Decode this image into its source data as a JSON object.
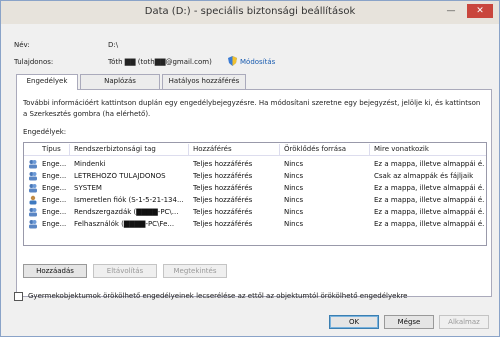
{
  "window": {
    "title": "Data (D:) - speciális biztonsági beállítások",
    "minimize_glyph": "—",
    "close_glyph": "✕"
  },
  "info": {
    "name_label": "Név:",
    "name_value": "D:\\",
    "owner_label": "Tulajdonos:",
    "owner_value": "Tóth ▇▇ (toth▇▇@gmail.com)",
    "change_link": "Módosítás",
    "change_icon": "shield-icon"
  },
  "tabs": [
    {
      "label": "Engedélyek",
      "active": true
    },
    {
      "label": "Naplózás",
      "active": false
    },
    {
      "label": "Hatályos hozzáférés",
      "active": false
    }
  ],
  "permissions": {
    "description": "További információért kattintson duplán egy engedélybejegyzésre. Ha módosítani szeretne egy bejegyzést, jelölje ki, és kattintson a Szerkesztés gombra (ha elérhető).",
    "list_label": "Engedélyek:",
    "columns": [
      "Típus",
      "Rendszerbiztonsági tag",
      "Hozzáférés",
      "Öröklődés forrása",
      "Mire vonatkozik"
    ],
    "rows": [
      {
        "type": "Enge...",
        "principal": "Mindenki",
        "access": "Teljes hozzáférés",
        "inherited": "Nincs",
        "applies": "Ez a mappa, illetve almappái é..."
      },
      {
        "type": "Enge...",
        "principal": "LÉTREHOZÓ TULAJDONOS",
        "access": "Teljes hozzáférés",
        "inherited": "Nincs",
        "applies": "Csak az almappák és fájljaik"
      },
      {
        "type": "Enge...",
        "principal": "SYSTEM",
        "access": "Teljes hozzáférés",
        "inherited": "Nincs",
        "applies": "Ez a mappa, illetve almappái é..."
      },
      {
        "type": "Enge...",
        "principal": "Ismeretlen fiók (S-1-5-21-134...",
        "access": "Teljes hozzáférés",
        "inherited": "Nincs",
        "applies": "Ez a mappa, illetve almappái é..."
      },
      {
        "type": "Enge...",
        "principal": "Rendszergazdák (▇▇▇▇-PC\\...",
        "access": "Teljes hozzáférés",
        "inherited": "Nincs",
        "applies": "Ez a mappa, illetve almappái é..."
      },
      {
        "type": "Enge...",
        "principal": "Felhasználók (▇▇▇▇-PC\\Fe...",
        "access": "Teljes hozzáférés",
        "inherited": "Nincs",
        "applies": "Ez a mappa, illetve almappái é..."
      }
    ]
  },
  "actions": {
    "add": "Hozzáadás",
    "remove": "Eltávolítás",
    "view": "Megtekintés"
  },
  "checkbox": {
    "label": "Gyermekobjektumok örökölhető engedélyeinek lecserélése az ettől az objektumtól örökölhető engedélyekre",
    "checked": false
  },
  "footer": {
    "ok": "OK",
    "cancel": "Mégse",
    "apply": "Alkalmaz"
  }
}
